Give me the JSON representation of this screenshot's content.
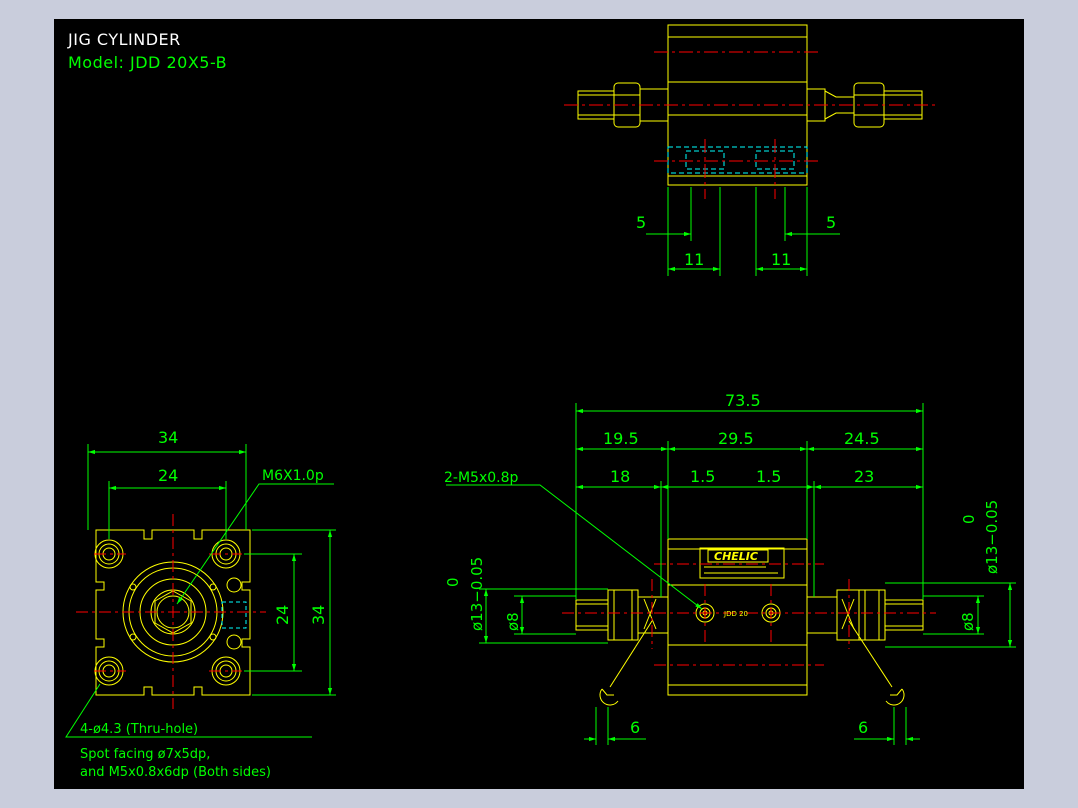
{
  "header": {
    "title": "JIG CYLINDER",
    "model": "Model:  JDD 20X5-B"
  },
  "colors": {
    "background": "#000000",
    "frame": "#c9cddc",
    "body": "#ffff00",
    "dimension": "#00ff00",
    "centerline": "#ff0000",
    "hidden": "#00ffff"
  },
  "top_view": {
    "dim_left_offset": "5",
    "dim_right_offset": "5",
    "dim_left_port": "11",
    "dim_right_port": "11"
  },
  "end_view": {
    "dim_outer_width": "34",
    "dim_hole_pitch_x": "24",
    "dim_hole_pitch_y": "24",
    "dim_outer_height": "34",
    "rod_thread": "M6X1.0p",
    "mount_hole": "4-ø4.3 (Thru-hole)",
    "note_line1": "Spot facing ø7x5dp,",
    "note_line2": "and M5x0.8x6dp (Both sides)"
  },
  "side_view": {
    "dim_total": "73.5",
    "dim_left_ext": "19.5",
    "dim_body": "29.5",
    "dim_right_ext": "24.5",
    "dim_left_rod": "18",
    "dim_left_gap": "1.5",
    "dim_right_gap": "1.5",
    "dim_right_rod": "23",
    "port_thread": "2-M5x0.8p",
    "rod_dia_left": "ø8",
    "rod_dia_right": "ø8",
    "tol_dia_left": "ø13−0.05",
    "tol_zero_left": "0",
    "tol_dia_right": "ø13−0.05",
    "tol_zero_right": "0",
    "wrench_left": "6",
    "wrench_right": "6",
    "brand_label": "CHELIC",
    "body_marking": "JDD 20"
  }
}
